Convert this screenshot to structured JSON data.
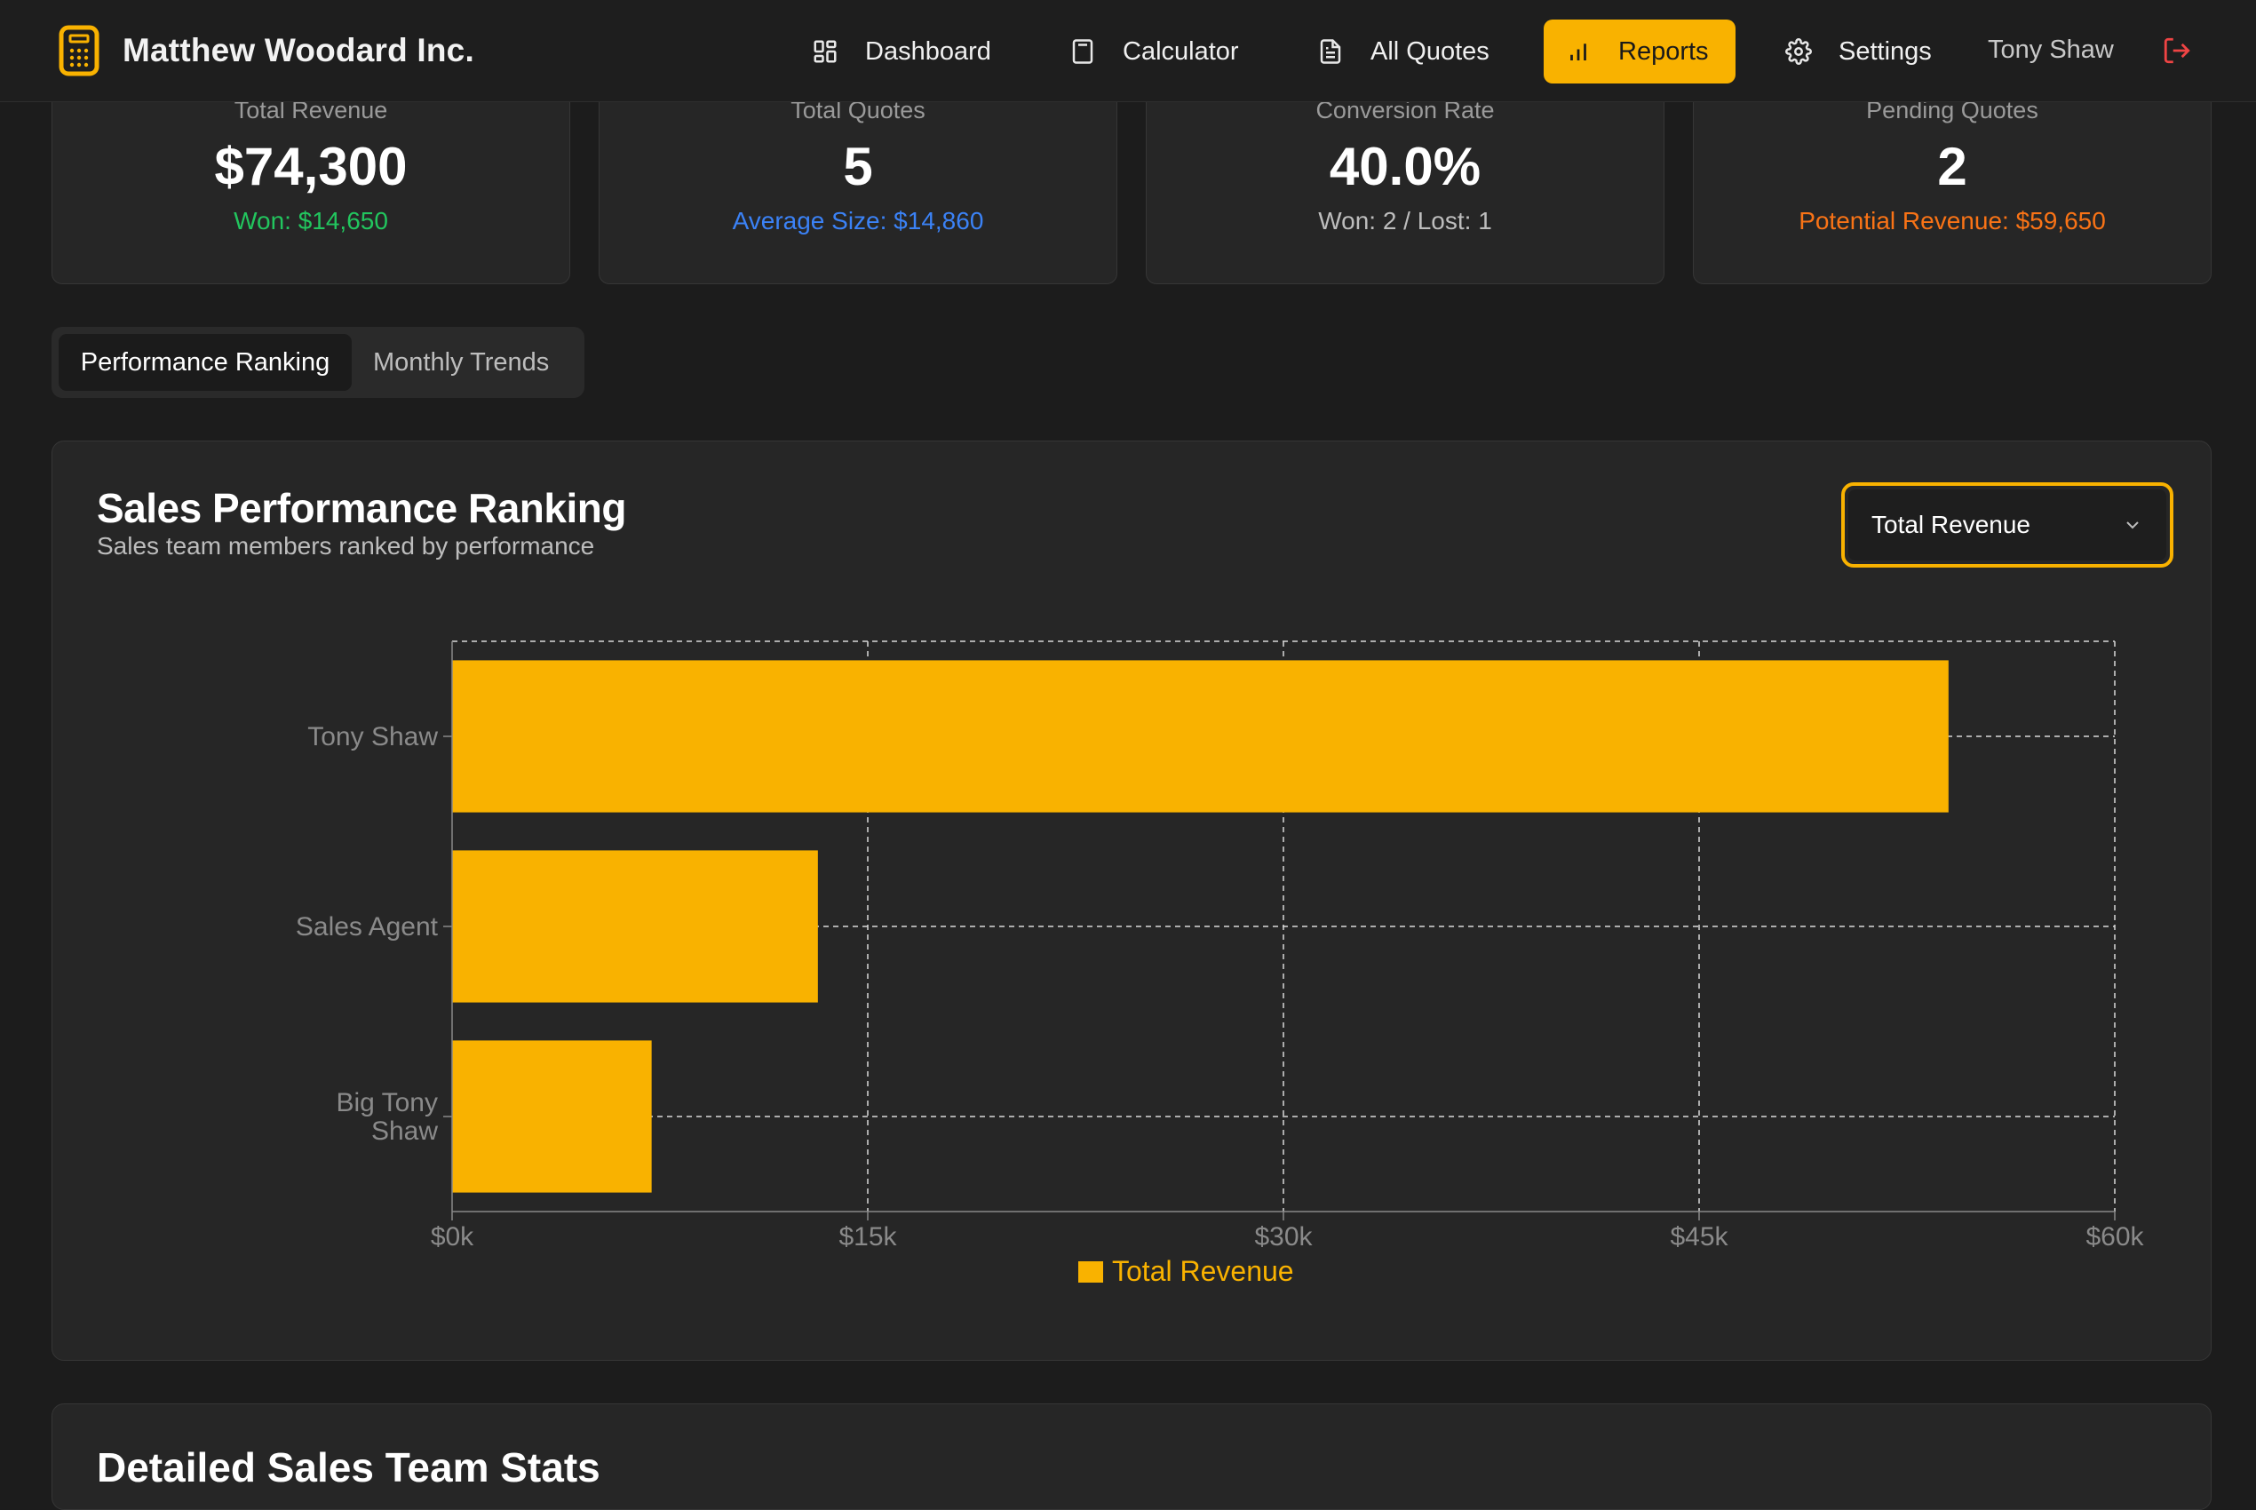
{
  "header": {
    "brand": "Matthew Woodard Inc.",
    "nav": [
      {
        "label": "Dashboard",
        "icon": "dashboard-icon"
      },
      {
        "label": "Calculator",
        "icon": "calculator-icon"
      },
      {
        "label": "All Quotes",
        "icon": "document-icon"
      },
      {
        "label": "Reports",
        "icon": "bar-chart-icon",
        "active": true
      },
      {
        "label": "Settings",
        "icon": "gear-icon"
      }
    ],
    "user": "Tony Shaw",
    "logout_icon": "logout-icon"
  },
  "stats": [
    {
      "label": "Total Revenue",
      "value": "$74,300",
      "sub": "Won: $14,650",
      "sub_color": "#22c55e"
    },
    {
      "label": "Total Quotes",
      "value": "5",
      "sub": "Average Size: $14,860",
      "sub_color": "#3b82f6"
    },
    {
      "label": "Conversion Rate",
      "value": "40.0%",
      "sub": "Won: 2 / Lost: 1",
      "sub_color": "#bdbdbd"
    },
    {
      "label": "Pending Quotes",
      "value": "2",
      "sub": "Potential Revenue: $59,650",
      "sub_color": "#f97316"
    }
  ],
  "tabs": [
    "Performance Ranking",
    "Monthly Trends"
  ],
  "ranking": {
    "title": "Sales Performance Ranking",
    "subtitle": "Sales team members ranked by performance",
    "metric_select": "Total Revenue"
  },
  "chart_data": {
    "type": "bar",
    "orientation": "horizontal",
    "categories": [
      "Tony Shaw",
      "Sales Agent",
      "Big Tony Shaw"
    ],
    "series": [
      {
        "name": "Total Revenue",
        "values": [
          54000,
          13200,
          7200
        ]
      }
    ],
    "xlim": [
      0,
      60000
    ],
    "x_ticks": [
      "$0k",
      "$15k",
      "$30k",
      "$45k",
      "$60k"
    ],
    "grid": true,
    "legend": "bottom",
    "color": "#f9b200"
  },
  "details": {
    "title": "Detailed Sales Team Stats"
  },
  "colors": {
    "accent": "#f9b200",
    "background": "#1c1c1c",
    "card": "#262626",
    "logout": "#ef4444"
  }
}
